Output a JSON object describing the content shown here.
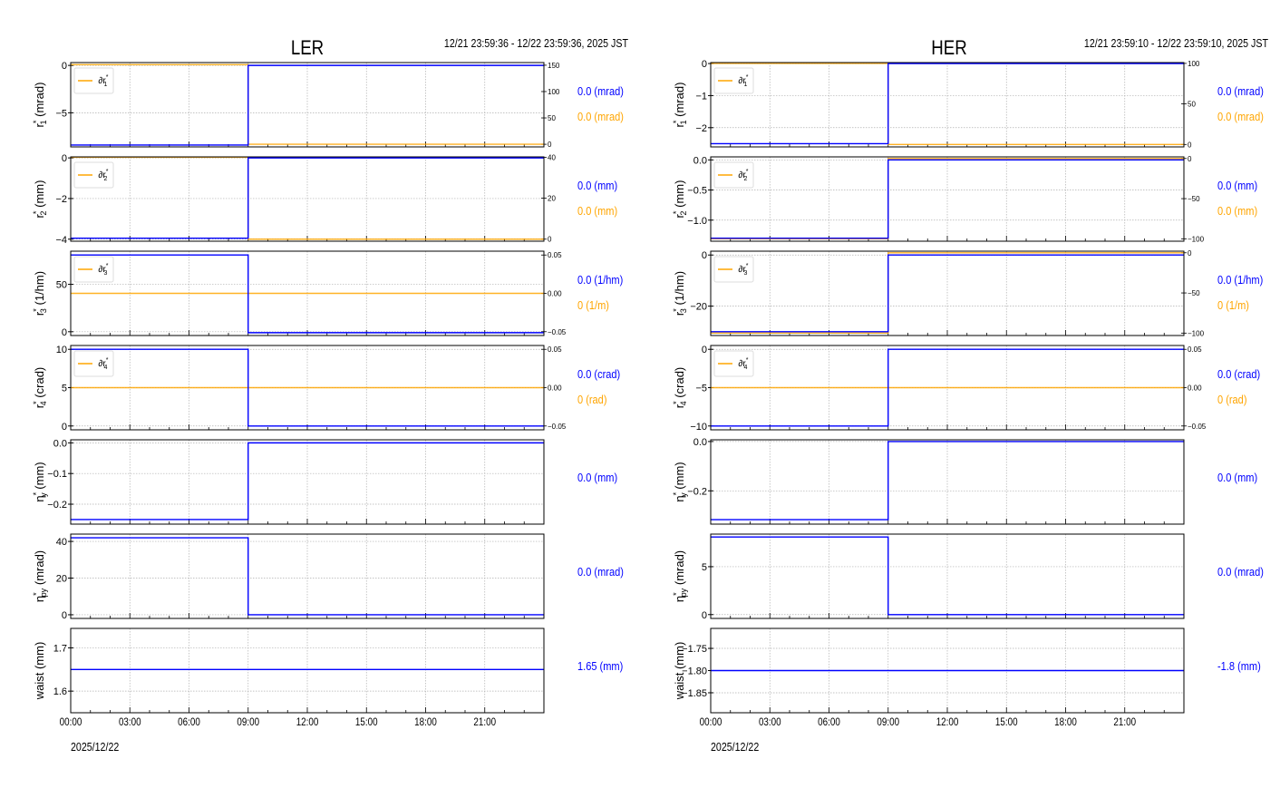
{
  "chart_data": [
    {
      "type": "line",
      "title": "LER",
      "time_range": "12/21 23:59:36 - 12/22 23:59:36, 2025 JST",
      "xlabel": "2025/12/22",
      "xlim_hours": [
        0,
        24
      ],
      "x_ticks": [
        "00:00",
        "03:00",
        "06:00",
        "09:00",
        "12:00",
        "15:00",
        "18:00",
        "21:00"
      ],
      "step_hour": 9,
      "panels": [
        {
          "ylabel": {
            "sym": "r",
            "sub": "1",
            "unit": "(mrad)"
          },
          "ylim": [
            -8.6,
            0.3
          ],
          "yticks": [
            0,
            -5
          ],
          "blue": [
            -8.4,
            0
          ],
          "value_blue": "0.0 (mrad)",
          "right": {
            "ylim": [
              -5,
              155
            ],
            "yticks": [
              0,
              50,
              100,
              150
            ],
            "orange": [
              151,
              0
            ],
            "legend": {
              "sym": "∂r",
              "sub": "1"
            },
            "value_orange": "0.0 (mrad)"
          }
        },
        {
          "ylabel": {
            "sym": "r",
            "sub": "2",
            "unit": "(mm)"
          },
          "ylim": [
            -4.1,
            0.05
          ],
          "yticks": [
            0,
            -2,
            -4
          ],
          "blue": [
            -3.95,
            0
          ],
          "value_blue": "0.0 (mm)",
          "right": {
            "ylim": [
              -1,
              40.2
            ],
            "yticks": [
              0,
              20,
              40
            ],
            "orange": [
              40,
              0
            ],
            "legend": {
              "sym": "∂r",
              "sub": "2"
            },
            "value_orange": "0.0 (mm)"
          }
        },
        {
          "ylabel": {
            "sym": "r",
            "sub": "3",
            "unit": "(1/hm)"
          },
          "ylim": [
            -4,
            85
          ],
          "yticks": [
            50,
            0
          ],
          "blue": [
            81,
            -1
          ],
          "value_blue": "0.0 (1/hm)",
          "right": {
            "ylim": [
              -0.055,
              0.055
            ],
            "yticks": [
              -0.05,
              0.0,
              0.05
            ],
            "tick_fmt": 2,
            "orange": [
              0,
              0
            ],
            "legend": {
              "sym": "∂r",
              "sub": "3"
            },
            "value_orange": "0 (1/m)"
          }
        },
        {
          "ylabel": {
            "sym": "r",
            "sub": "4",
            "unit": "(crad)"
          },
          "ylim": [
            -0.5,
            10.5
          ],
          "yticks": [
            10,
            5,
            0
          ],
          "blue": [
            10,
            0
          ],
          "value_blue": "0.0 (crad)",
          "right": {
            "ylim": [
              -0.055,
              0.055
            ],
            "yticks": [
              -0.05,
              0.0,
              0.05
            ],
            "tick_fmt": 2,
            "orange": [
              0,
              0
            ],
            "legend": {
              "sym": "∂r",
              "sub": "4"
            },
            "value_orange": "0 (rad)"
          }
        },
        {
          "ylabel": {
            "sym": "η",
            "sub": "y",
            "unit": "(mm)"
          },
          "ylim": [
            -0.265,
            0.01
          ],
          "yticks": [
            0.0,
            -0.1,
            -0.2
          ],
          "tick_fmt": 1,
          "blue": [
            -0.25,
            0
          ],
          "value_blue": "0.0 (mm)"
        },
        {
          "ylabel": {
            "sym": "η",
            "sub": "py",
            "unit": "(mrad)"
          },
          "ylim": [
            -2,
            44
          ],
          "yticks": [
            40,
            20,
            0
          ],
          "blue": [
            42,
            0
          ],
          "value_blue": "0.0 (mrad)"
        },
        {
          "ylabel": {
            "sym": "waist",
            "sub": "",
            "unit": "(mm)",
            "plain": true
          },
          "ylim": [
            1.55,
            1.745
          ],
          "yticks": [
            1.7,
            1.6
          ],
          "tick_fmt": 1,
          "blue": [
            1.65,
            1.65
          ],
          "value_blue": "1.65 (mm)"
        }
      ]
    },
    {
      "type": "line",
      "title": "HER",
      "time_range": "12/21 23:59:10 - 12/22 23:59:10, 2025 JST",
      "xlabel": "2025/12/22",
      "xlim_hours": [
        0,
        24
      ],
      "x_ticks": [
        "00:00",
        "03:00",
        "06:00",
        "09:00",
        "12:00",
        "15:00",
        "18:00",
        "21:00"
      ],
      "step_hour": 9,
      "panels": [
        {
          "ylabel": {
            "sym": "r",
            "sub": "1",
            "unit": "(mrad)"
          },
          "ylim": [
            -2.6,
            0.03
          ],
          "yticks": [
            0,
            -1,
            -2
          ],
          "blue": [
            -2.5,
            0
          ],
          "value_blue": "0.0 (mrad)",
          "right": {
            "ylim": [
              -3,
              101
            ],
            "yticks": [
              0,
              50,
              100
            ],
            "orange": [
              100,
              0
            ],
            "legend": {
              "sym": "∂r",
              "sub": "1"
            },
            "value_orange": "0.0 (mrad)"
          }
        },
        {
          "ylabel": {
            "sym": "r",
            "sub": "2",
            "unit": "(mm)"
          },
          "ylim": [
            -1.35,
            0.05
          ],
          "yticks": [
            0.0,
            -0.5,
            -1.0
          ],
          "tick_fmt": 1,
          "blue": [
            -1.3,
            0
          ],
          "value_blue": "0.0 (mm)",
          "right": {
            "ylim": [
              -103,
              2
            ],
            "yticks": [
              0,
              -50,
              -100
            ],
            "orange": [
              -100,
              0
            ],
            "legend": {
              "sym": "∂r",
              "sub": "2"
            },
            "value_orange": "0.0 (mm)"
          }
        },
        {
          "ylabel": {
            "sym": "r",
            "sub": "3",
            "unit": "(1/hm)"
          },
          "ylim": [
            -31.5,
            1.5
          ],
          "yticks": [
            0,
            -20
          ],
          "blue": [
            -30,
            0
          ],
          "value_blue": "0.0 (1/hm)",
          "right": {
            "ylim": [
              -103,
              2
            ],
            "yticks": [
              0,
              -50,
              -100
            ],
            "orange": [
              -100,
              0
            ],
            "legend": {
              "sym": "∂r",
              "sub": "3"
            },
            "value_orange": "0 (1/m)"
          }
        },
        {
          "ylabel": {
            "sym": "r",
            "sub": "4",
            "unit": "(crad)"
          },
          "ylim": [
            -10.5,
            0.5
          ],
          "yticks": [
            0,
            -5,
            -10
          ],
          "blue": [
            -10,
            0
          ],
          "value_blue": "0.0 (crad)",
          "right": {
            "ylim": [
              -0.055,
              0.055
            ],
            "yticks": [
              -0.05,
              0.0,
              0.05
            ],
            "tick_fmt": 2,
            "orange": [
              0,
              0
            ],
            "legend": {
              "sym": "∂r",
              "sub": "4"
            },
            "value_orange": "0 (rad)"
          }
        },
        {
          "ylabel": {
            "sym": "η",
            "sub": "y",
            "unit": "(mm)"
          },
          "ylim": [
            -0.335,
            0.007
          ],
          "yticks": [
            0.0,
            -0.2
          ],
          "tick_fmt": 1,
          "blue": [
            -0.317,
            0
          ],
          "value_blue": "0.0 (mm)"
        },
        {
          "ylabel": {
            "sym": "η",
            "sub": "py",
            "unit": "(mrad)"
          },
          "ylim": [
            -0.4,
            8.4
          ],
          "yticks": [
            5,
            0
          ],
          "blue": [
            8.1,
            0
          ],
          "value_blue": "0.0 (mrad)"
        },
        {
          "ylabel": {
            "sym": "waist",
            "sub": "",
            "unit": "(mm)",
            "plain": true
          },
          "ylim": [
            -1.895,
            -1.705
          ],
          "yticks": [
            -1.75,
            -1.8,
            -1.85
          ],
          "tick_fmt": 2,
          "blue": [
            -1.8,
            -1.8
          ],
          "value_blue": "-1.8 (mm)"
        }
      ]
    }
  ],
  "colors": {
    "blue": "#0000ff",
    "orange": "#ffa500",
    "grid": "#b0b0b0",
    "axis": "#000000"
  }
}
